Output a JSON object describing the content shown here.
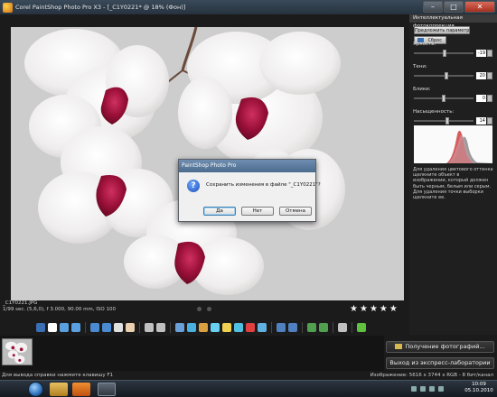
{
  "window": {
    "title": "Corel PaintShop Photo Pro X3 - [_C1Y0221* @  18% (Фон)]",
    "controls": [
      "–",
      "□",
      "✕"
    ]
  },
  "image_info": {
    "filename": "_C1Y0221.JPG",
    "details": "1/99 sec. (5,6,0), f 3.000, 90.00 mm, ISO 100"
  },
  "rating": {
    "stars": 5
  },
  "panel": {
    "title": "Интеллектуальная фотокоррекция",
    "suggest_button": "Предложить параметры",
    "reset_button": "Сброс",
    "sliders": [
      {
        "label": "Яркость:",
        "value": "-19",
        "level": 0.52
      },
      {
        "label": "Тени:",
        "value": "20",
        "level": 0.55
      },
      {
        "label": "Блики:",
        "value": "0",
        "level": 0.5
      },
      {
        "label": "Насыщенность:",
        "value": "14",
        "level": 0.56
      }
    ],
    "description": "Для удаления цветового оттенка щелкните объект в изображении, который должен быть черным, белым или серым. Для удаления точки выборки щелкните ее."
  },
  "buttons": {
    "get_photos": "Получение фотографий...",
    "exit_express": "Выход из экспресс-лаборатории"
  },
  "status": {
    "left": "Для вывода справки нажмите клавишу F1",
    "right": "Изображение:  5616 x 3744 x RGB - 8 бит/канал"
  },
  "dialog": {
    "title": "PaintShop Photo Pro",
    "icon": "?",
    "message": "Сохранить изменения в файле \"_C1Y0221\"?",
    "yes": "Да",
    "no": "Нет",
    "cancel": "Отмена"
  },
  "taskbar": {
    "time": "10:09",
    "date": "05.10.2010"
  },
  "colors": {
    "accent": "#4a6b8f",
    "orchid_petal": "#f4f2f2",
    "orchid_lip": "#9a1038",
    "histogram_red": "#d04040",
    "histogram_gray": "#8a8a8a"
  }
}
